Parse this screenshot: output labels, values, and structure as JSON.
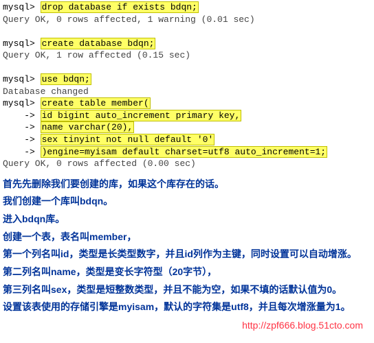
{
  "terminal": {
    "p1": "mysql> ",
    "cont": "    -> ",
    "cmd1": "drop database if exists bdqn;",
    "res1": "Query OK, 0 rows affected, 1 warning (0.01 sec)",
    "cmd2": "create database bdqn;",
    "res2": "Query OK, 1 row affected (0.15 sec)",
    "cmd3": "use bdqn;",
    "res3": "Database changed",
    "ct_l1": "create table member(",
    "ct_l2": "id bigint auto_increment primary key,",
    "ct_l3": "name varchar(20),",
    "ct_l4": "sex tinyint not null default '0'",
    "ct_l5": ")engine=myisam default charset=utf8 auto_increment=1;",
    "res4": "Query OK, 0 rows affected (0.00 sec)"
  },
  "annotation": {
    "l1": "首先先删除我们要创建的库，如果这个库存在的话。",
    "l2": "我们创建一个库叫bdqn。",
    "l3": "进入bdqn库。",
    "l4": "创建一个表，表名叫member，",
    "l5": "第一个列名叫id，类型是长类型数字，并且id列作为主键，同时设置可以自动增涨。",
    "l6": "第二列名叫name，类型是变长字符型（20字节），",
    "l7": "第三列名叫sex，类型是短整数类型，并且不能为空，如果不填的话默认值为0。",
    "l8": "设置该表使用的存储引擎是myisam，默认的字符集是utf8，并且每次增涨量为1。"
  },
  "watermark": "http://zpf666.blog.51cto.com"
}
